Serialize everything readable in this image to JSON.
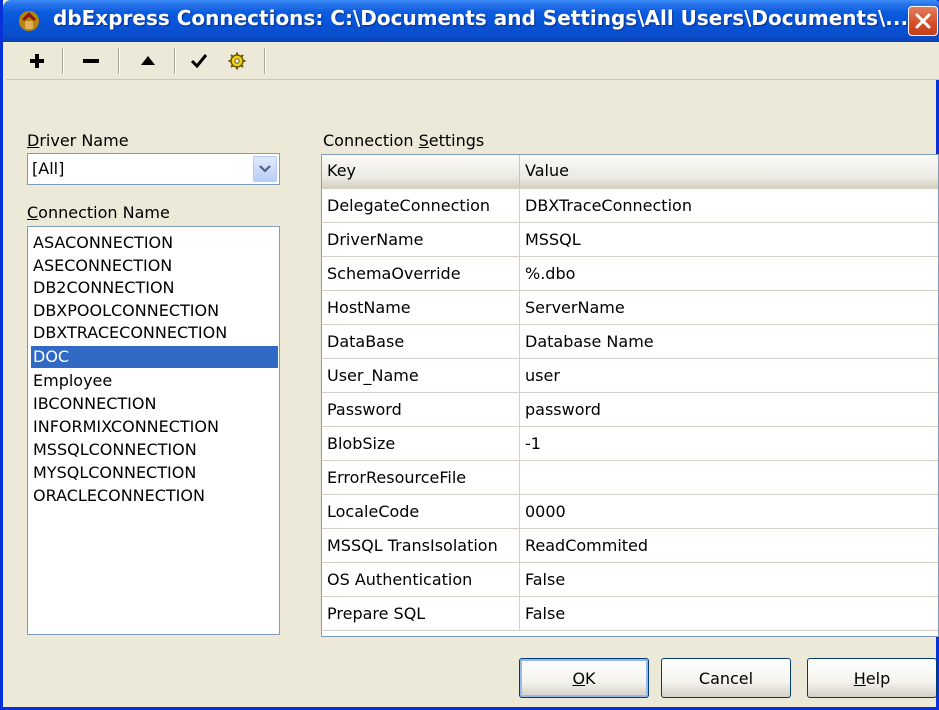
{
  "window": {
    "title": "dbExpress Connections: C:\\Documents and Settings\\All Users\\Documents\\..."
  },
  "toolbar": {
    "buttons": [
      {
        "name": "add",
        "icon": "plus-icon"
      },
      {
        "name": "remove",
        "icon": "minus-icon"
      },
      {
        "name": "rename",
        "icon": "triangle-up-icon"
      },
      {
        "name": "test",
        "icon": "checkmark-icon"
      },
      {
        "name": "settings",
        "icon": "gear-icon"
      }
    ]
  },
  "driver_name": {
    "label_prefix": "",
    "label_accel": "D",
    "label_rest": "river Name",
    "selected": "[All]"
  },
  "connection_name": {
    "label_accel": "C",
    "label_rest": "onnection Name",
    "items": [
      "ASACONNECTION",
      "ASECONNECTION",
      "DB2CONNECTION",
      "DBXPOOLCONNECTION",
      "DBXTRACECONNECTION",
      "DOC",
      "Employee",
      "IBCONNECTION",
      "INFORMIXCONNECTION",
      "MSSQLCONNECTION",
      "MYSQLCONNECTION",
      "ORACLECONNECTION"
    ],
    "selected": "DOC"
  },
  "connection_settings": {
    "label_prefix": "Connection ",
    "label_accel": "S",
    "label_rest": "ettings",
    "columns": {
      "key": "Key",
      "value": "Value"
    },
    "rows": [
      {
        "key": "DelegateConnection",
        "value": "DBXTraceConnection"
      },
      {
        "key": "DriverName",
        "value": "MSSQL"
      },
      {
        "key": "SchemaOverride",
        "value": "%.dbo"
      },
      {
        "key": "HostName",
        "value": "ServerName"
      },
      {
        "key": "DataBase",
        "value": "Database Name"
      },
      {
        "key": "User_Name",
        "value": "user"
      },
      {
        "key": "Password",
        "value": "password"
      },
      {
        "key": "BlobSize",
        "value": "-1"
      },
      {
        "key": "ErrorResourceFile",
        "value": ""
      },
      {
        "key": "LocaleCode",
        "value": "0000"
      },
      {
        "key": "MSSQL TransIsolation",
        "value": "ReadCommited"
      },
      {
        "key": "OS Authentication",
        "value": "False"
      },
      {
        "key": "Prepare SQL",
        "value": "False"
      }
    ]
  },
  "buttons": {
    "ok_accel": "O",
    "ok_rest": "K",
    "cancel": "Cancel",
    "help_accel": "H",
    "help_rest": "elp"
  },
  "colors": {
    "titlebar": "#0A5CDE",
    "selection": "#316AC5",
    "dialog_bg": "#ECE9D8",
    "close_button": "#D44D27"
  }
}
